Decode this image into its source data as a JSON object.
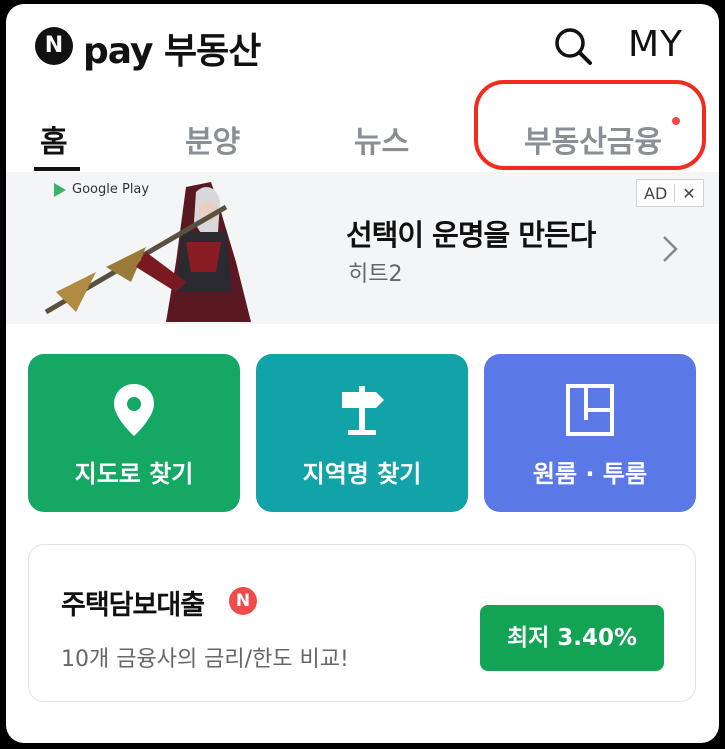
{
  "header": {
    "logo_mark": "N",
    "logo_text": "pay 부동산",
    "search_icon": "search-icon",
    "my_label": "MY"
  },
  "tabs": [
    {
      "label": "홈",
      "active": true
    },
    {
      "label": "분양",
      "active": false
    },
    {
      "label": "뉴스",
      "active": false
    },
    {
      "label": "부동산금융",
      "active": false,
      "has_notification_dot": true
    }
  ],
  "ad": {
    "store_label": "Google Play",
    "badge_label": "AD",
    "close_label": "✕",
    "title": "선택이 운명을 만든다",
    "subtitle": "히트2"
  },
  "shortcuts": [
    {
      "label": "지도로 찾기",
      "icon": "map-pin-icon",
      "color": "#14a864"
    },
    {
      "label": "지역명 찾기",
      "icon": "signpost-icon",
      "color": "#12a3a8"
    },
    {
      "label": "원룸 · 투룸",
      "icon": "floorplan-icon",
      "color": "#5a78e6"
    }
  ],
  "loan": {
    "title": "주택담보대출",
    "badge": "N",
    "description": "10개 금융사의 금리/한도 비교!",
    "button_label": "최저 3.40%",
    "button_color": "#12a454"
  },
  "colors": {
    "highlight": "#f22b1e",
    "notification_dot": "#f04848"
  }
}
